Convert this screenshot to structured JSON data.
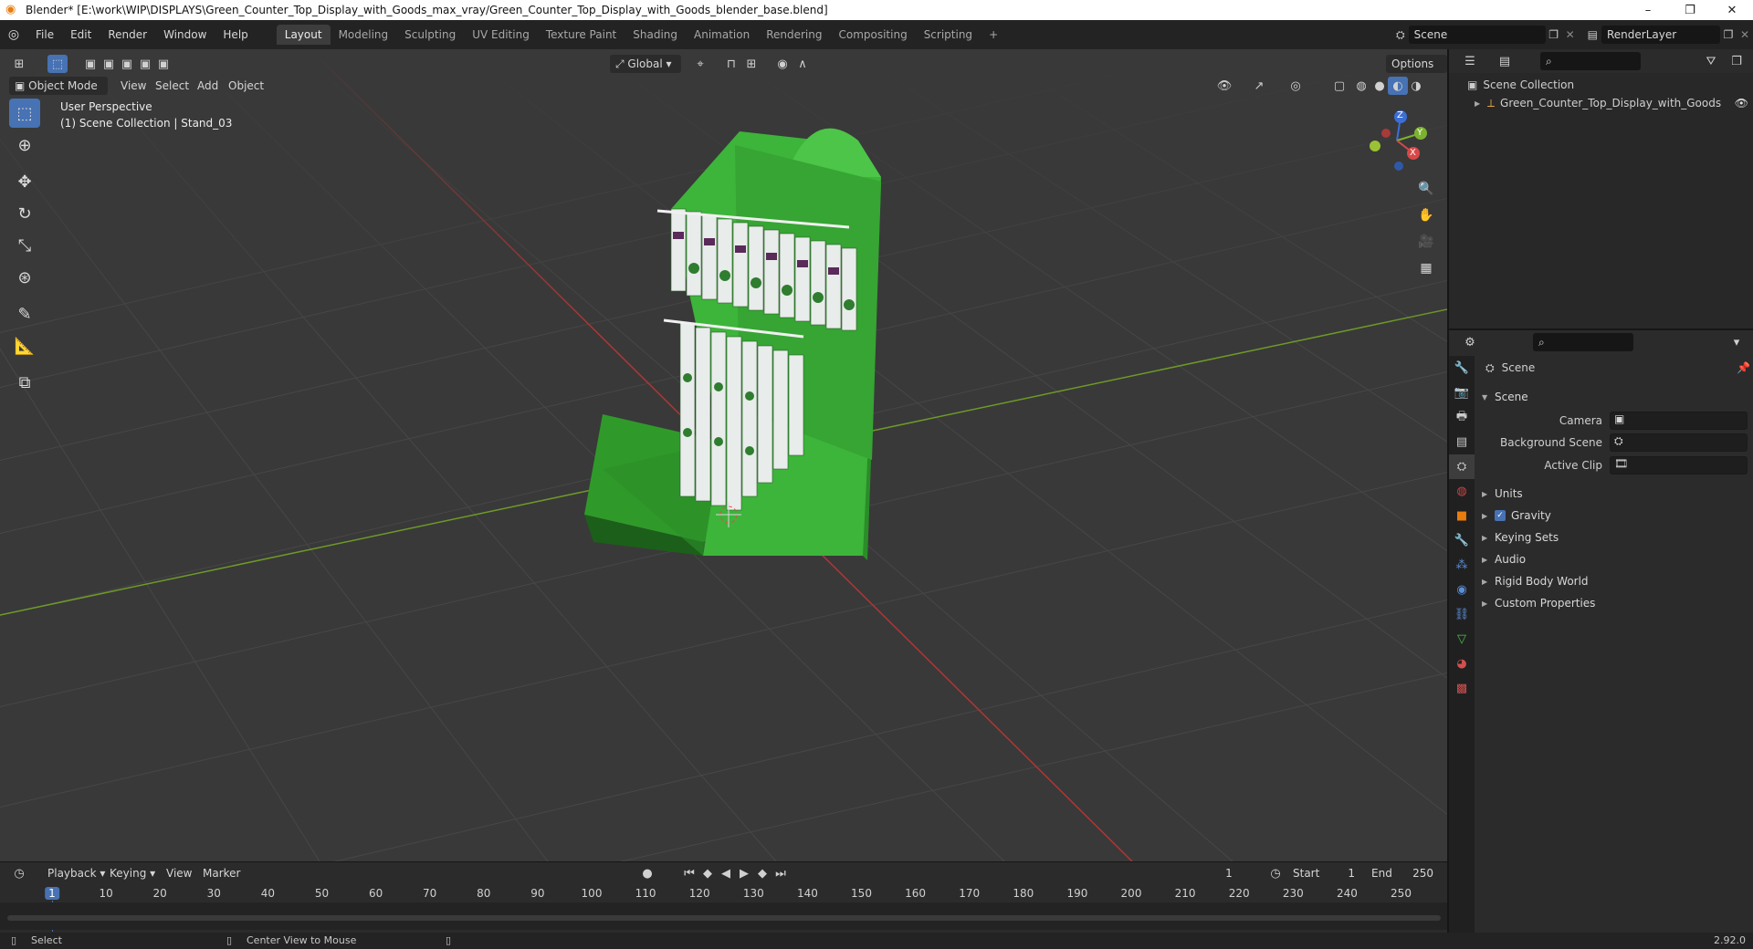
{
  "window": {
    "title": "Blender* [E:\\work\\WIP\\DISPLAYS\\Green_Counter_Top_Display_with_Goods_max_vray/Green_Counter_Top_Display_with_Goods_blender_base.blend]",
    "minimize": "–",
    "maximize": "❐",
    "close": "✕"
  },
  "menubar": {
    "menus": [
      "File",
      "Edit",
      "Render",
      "Window",
      "Help"
    ],
    "workspaces": [
      "Layout",
      "Modeling",
      "Sculpting",
      "UV Editing",
      "Texture Paint",
      "Shading",
      "Animation",
      "Rendering",
      "Compositing",
      "Scripting"
    ],
    "active_workspace": "Layout",
    "add_tab": "+",
    "scene": "Scene",
    "view_layer": "RenderLayer"
  },
  "viewport": {
    "mode": "Object Mode",
    "menus": [
      "View",
      "Select",
      "Add",
      "Object"
    ],
    "orientation": "Global",
    "options": "Options",
    "info_line1": "User Perspective",
    "info_line2": "(1) Scene Collection | Stand_03",
    "gizmo_axes": [
      "Z",
      "Y",
      "X"
    ]
  },
  "timeline": {
    "menus": [
      "Playback",
      "Keying",
      "View",
      "Marker"
    ],
    "current_frame": "1",
    "start_label": "Start",
    "start": "1",
    "end_label": "End",
    "end": "250",
    "ruler": [
      "1",
      "10",
      "20",
      "30",
      "40",
      "50",
      "60",
      "70",
      "80",
      "90",
      "100",
      "110",
      "120",
      "130",
      "140",
      "150",
      "160",
      "170",
      "180",
      "190",
      "200",
      "210",
      "220",
      "230",
      "240",
      "250"
    ]
  },
  "statusbar": {
    "left": "Select",
    "middle": "Center View to Mouse",
    "version": "2.92.0"
  },
  "outliner": {
    "root": "Scene Collection",
    "items": [
      "Green_Counter_Top_Display_with_Goods"
    ]
  },
  "properties": {
    "context": "Scene",
    "panel": "Scene",
    "fields": [
      {
        "label": "Camera"
      },
      {
        "label": "Background Scene"
      },
      {
        "label": "Active Clip"
      }
    ],
    "subpanels": [
      "Units",
      "Gravity",
      "Keying Sets",
      "Audio",
      "Rigid Body World",
      "Custom Properties"
    ],
    "gravity_checked": true
  },
  "colors": {
    "accent": "#4772b3",
    "model_green": "#3aa53a",
    "x_axis": "#c93b3b",
    "y_axis": "#7aa52a"
  }
}
